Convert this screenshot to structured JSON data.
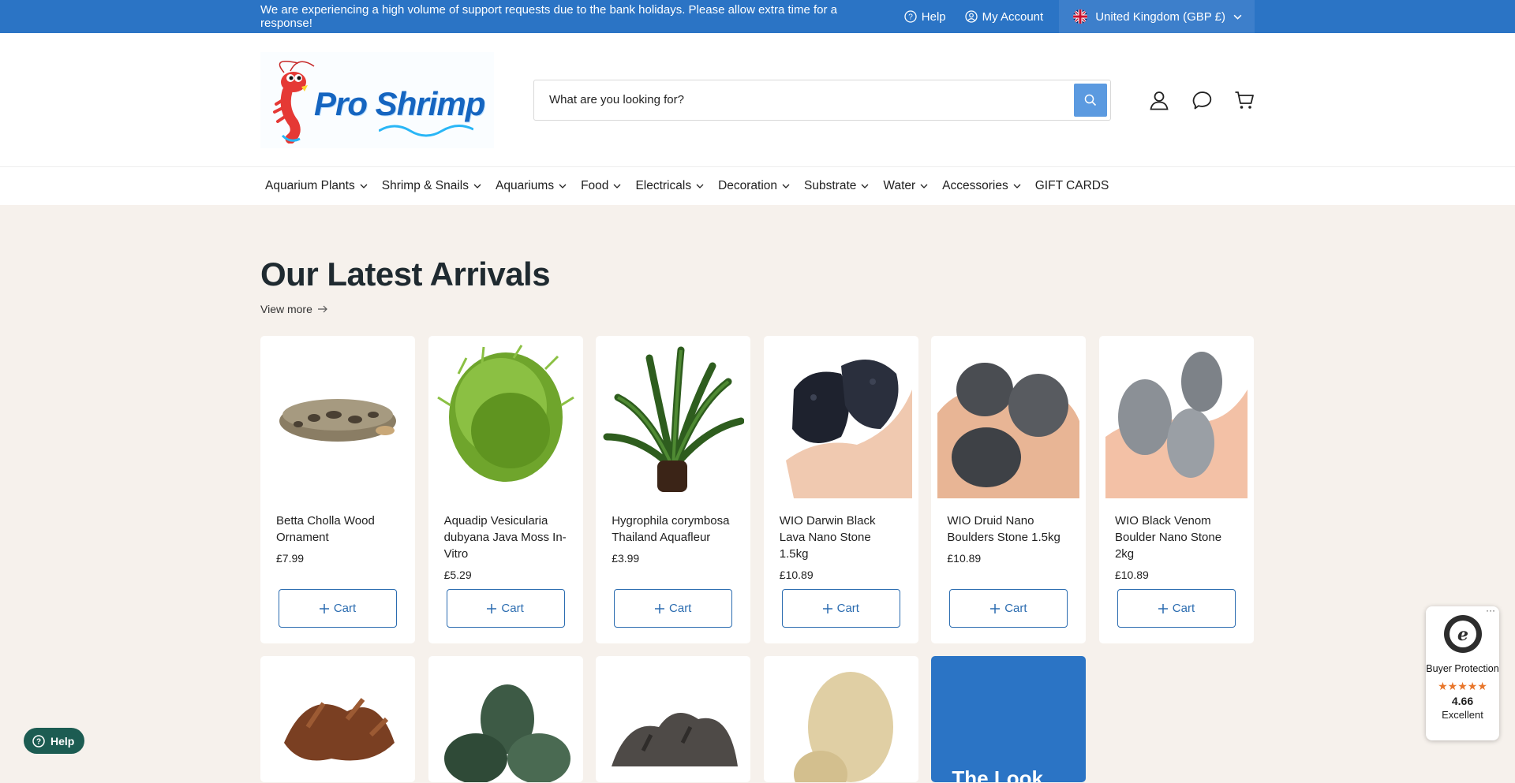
{
  "topbar": {
    "message": "We are experiencing a high volume of support requests due to the bank holidays. Please allow extra time for a response!",
    "help": "Help",
    "account": "My Account",
    "country": "United Kingdom (GBP £)"
  },
  "header": {
    "logo_text": "Pro Shrimp",
    "search_placeholder": "What are you looking for?"
  },
  "nav": {
    "items": [
      "Aquarium Plants",
      "Shrimp & Snails",
      "Aquariums",
      "Food",
      "Electricals",
      "Decoration",
      "Substrate",
      "Water",
      "Accessories"
    ],
    "gift": "GIFT CARDS"
  },
  "section": {
    "title": "Our Latest Arrivals",
    "view_more": "View more"
  },
  "products": [
    {
      "name": "Betta Cholla Wood Ornament",
      "price": "£7.99",
      "cart": "Cart"
    },
    {
      "name": "Aquadip Vesicularia dubyana Java Moss In-Vitro",
      "price": "£5.29",
      "cart": "Cart"
    },
    {
      "name": "Hygrophila corymbosa Thailand Aquafleur",
      "price": "£3.99",
      "cart": "Cart"
    },
    {
      "name": "WIO Darwin Black Lava Nano Stone 1.5kg",
      "price": "£10.89",
      "cart": "Cart"
    },
    {
      "name": "WIO Druid Nano Boulders Stone 1.5kg",
      "price": "£10.89",
      "cart": "Cart"
    },
    {
      "name": "WIO Black Venom Boulder Nano Stone 2kg",
      "price": "£10.89",
      "cart": "Cart"
    }
  ],
  "promo_text": "The Look",
  "help_widget": "Help",
  "trust": {
    "label": "Buyer Protection",
    "stars": "★★★★★",
    "score": "4.66",
    "rating": "Excellent"
  },
  "colors": {
    "topbar": "#2b74c5",
    "accent": "#2b6cb0",
    "page_bg": "#f6f1ec",
    "help_btn": "#1c5c52",
    "stars": "#e8762b"
  }
}
